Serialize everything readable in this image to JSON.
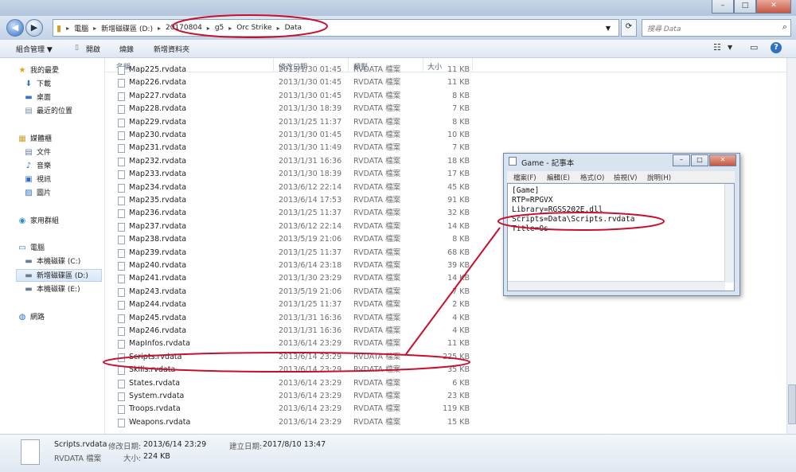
{
  "address": {
    "crumbs": [
      "電腦",
      "新增磁碟區 (D:)",
      "20170804",
      "g5",
      "Orc Strike",
      "Data"
    ],
    "search_placeholder": "搜尋 Data"
  },
  "toolbar": {
    "organize": "組合管理 ▼",
    "open": "開啟",
    "burn": "燒錄",
    "new_folder": "新增資料夾"
  },
  "sidebar": {
    "items": [
      {
        "label": "我的最愛",
        "icon": "star-icon"
      },
      {
        "label": "下載",
        "icon": "download-icon"
      },
      {
        "label": "桌面",
        "icon": "desktop-icon"
      },
      {
        "label": "最近的位置",
        "icon": "recent-icon"
      },
      {
        "label": "媒體櫃",
        "icon": "library-icon"
      },
      {
        "label": "文件",
        "icon": "document-icon"
      },
      {
        "label": "音樂",
        "icon": "music-icon"
      },
      {
        "label": "視訊",
        "icon": "video-icon"
      },
      {
        "label": "圖片",
        "icon": "picture-icon"
      },
      {
        "label": "家用群組",
        "icon": "homegroup-icon"
      },
      {
        "label": "電腦",
        "icon": "computer-icon"
      },
      {
        "label": "本機磁碟 (C:)",
        "icon": "drive-icon"
      },
      {
        "label": "新增磁碟區 (D:)",
        "icon": "drive-icon"
      },
      {
        "label": "本機磁碟 (E:)",
        "icon": "drive-icon"
      },
      {
        "label": "網路",
        "icon": "network-icon"
      }
    ]
  },
  "columns": {
    "name": "名稱",
    "date": "修改日期",
    "type": "類型",
    "size": "大小"
  },
  "files": [
    {
      "name": "Map225.rvdata",
      "date": "2013/1/30 01:45",
      "type": "RVDATA 檔案",
      "size": "11 KB"
    },
    {
      "name": "Map226.rvdata",
      "date": "2013/1/30 01:45",
      "type": "RVDATA 檔案",
      "size": "11 KB"
    },
    {
      "name": "Map227.rvdata",
      "date": "2013/1/30 01:45",
      "type": "RVDATA 檔案",
      "size": "8 KB"
    },
    {
      "name": "Map228.rvdata",
      "date": "2013/1/30 18:39",
      "type": "RVDATA 檔案",
      "size": "7 KB"
    },
    {
      "name": "Map229.rvdata",
      "date": "2013/1/25 11:37",
      "type": "RVDATA 檔案",
      "size": "8 KB"
    },
    {
      "name": "Map230.rvdata",
      "date": "2013/1/30 01:45",
      "type": "RVDATA 檔案",
      "size": "10 KB"
    },
    {
      "name": "Map231.rvdata",
      "date": "2013/1/30 11:49",
      "type": "RVDATA 檔案",
      "size": "7 KB"
    },
    {
      "name": "Map232.rvdata",
      "date": "2013/1/31 16:36",
      "type": "RVDATA 檔案",
      "size": "18 KB"
    },
    {
      "name": "Map233.rvdata",
      "date": "2013/1/30 18:39",
      "type": "RVDATA 檔案",
      "size": "17 KB"
    },
    {
      "name": "Map234.rvdata",
      "date": "2013/6/12 22:14",
      "type": "RVDATA 檔案",
      "size": "45 KB"
    },
    {
      "name": "Map235.rvdata",
      "date": "2013/6/14 17:53",
      "type": "RVDATA 檔案",
      "size": "91 KB"
    },
    {
      "name": "Map236.rvdata",
      "date": "2013/1/25 11:37",
      "type": "RVDATA 檔案",
      "size": "32 KB"
    },
    {
      "name": "Map237.rvdata",
      "date": "2013/6/12 22:14",
      "type": "RVDATA 檔案",
      "size": "14 KB"
    },
    {
      "name": "Map238.rvdata",
      "date": "2013/5/19 21:06",
      "type": "RVDATA 檔案",
      "size": "8 KB"
    },
    {
      "name": "Map239.rvdata",
      "date": "2013/1/25 11:37",
      "type": "RVDATA 檔案",
      "size": "68 KB"
    },
    {
      "name": "Map240.rvdata",
      "date": "2013/6/14 23:18",
      "type": "RVDATA 檔案",
      "size": "39 KB"
    },
    {
      "name": "Map241.rvdata",
      "date": "2013/1/30 23:29",
      "type": "RVDATA 檔案",
      "size": "14 KB"
    },
    {
      "name": "Map243.rvdata",
      "date": "2013/5/19 21:06",
      "type": "RVDATA 檔案",
      "size": "7 KB"
    },
    {
      "name": "Map244.rvdata",
      "date": "2013/1/25 11:37",
      "type": "RVDATA 檔案",
      "size": "2 KB"
    },
    {
      "name": "Map245.rvdata",
      "date": "2013/1/31 16:36",
      "type": "RVDATA 檔案",
      "size": "4 KB"
    },
    {
      "name": "Map246.rvdata",
      "date": "2013/1/31 16:36",
      "type": "RVDATA 檔案",
      "size": "4 KB"
    },
    {
      "name": "MapInfos.rvdata",
      "date": "2013/6/14 23:29",
      "type": "RVDATA 檔案",
      "size": "11 KB"
    },
    {
      "name": "Scripts.rvdata",
      "date": "2013/6/14 23:29",
      "type": "RVDATA 檔案",
      "size": "225 KB"
    },
    {
      "name": "Skills.rvdata",
      "date": "2013/6/14 23:29",
      "type": "RVDATA 檔案",
      "size": "35 KB"
    },
    {
      "name": "States.rvdata",
      "date": "2013/6/14 23:29",
      "type": "RVDATA 檔案",
      "size": "6 KB"
    },
    {
      "name": "System.rvdata",
      "date": "2013/6/14 23:29",
      "type": "RVDATA 檔案",
      "size": "23 KB"
    },
    {
      "name": "Troops.rvdata",
      "date": "2013/6/14 23:29",
      "type": "RVDATA 檔案",
      "size": "119 KB"
    },
    {
      "name": "Weapons.rvdata",
      "date": "2013/6/14 23:29",
      "type": "RVDATA 檔案",
      "size": "15 KB"
    }
  ],
  "details": {
    "filename": "Scripts.rvdata",
    "modified_label": "修改日期:",
    "modified_value": "2013/6/14 23:29",
    "created_label": "建立日期:",
    "created_value": "2017/8/10 13:47",
    "type": "RVDATA 檔案",
    "size_label": "大小:",
    "size_value": "224 KB"
  },
  "notepad": {
    "title": "Game - 記事本",
    "menu": [
      "檔案(F)",
      "編輯(E)",
      "格式(O)",
      "檢視(V)",
      "說明(H)"
    ],
    "lines": [
      "[Game]",
      "RTP=RPGVX",
      "Library=RGSS202E.dll",
      "Scripts=Data\\Scripts.rvdata",
      "Title=Os"
    ]
  },
  "colors": {
    "annotation": "#c8102e",
    "selection": "#d7e6f7"
  }
}
